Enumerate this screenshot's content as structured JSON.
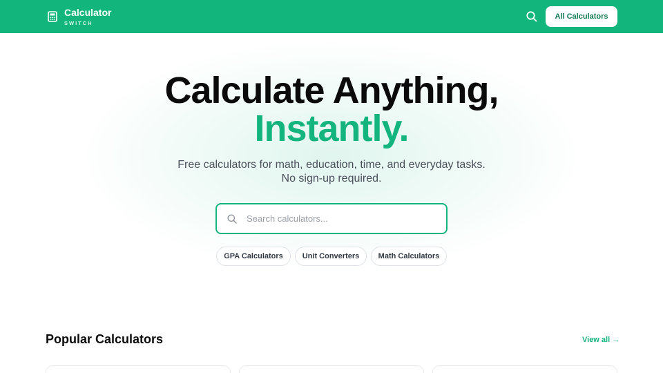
{
  "header": {
    "brand_name": "Calculator",
    "brand_sub": "SWITCH",
    "all_calculators_label": "All Calculators",
    "brand_icon": "calculator-icon",
    "search_icon": "search-icon"
  },
  "hero": {
    "title_line1": "Calculate Anything,",
    "title_line2": "Instantly.",
    "subtitle_line1": "Free calculators for math, education, time, and everyday tasks.",
    "subtitle_line2": "No sign-up required.",
    "search_placeholder": "Search calculators...",
    "chips": [
      "GPA Calculators",
      "Unit Converters",
      "Math Calculators"
    ]
  },
  "popular": {
    "title": "Popular Calculators",
    "view_all": "View all →"
  },
  "colors": {
    "brand_green": "#12b67d",
    "accent_green": "#14b47e",
    "text_dark": "#0b0b0b"
  }
}
